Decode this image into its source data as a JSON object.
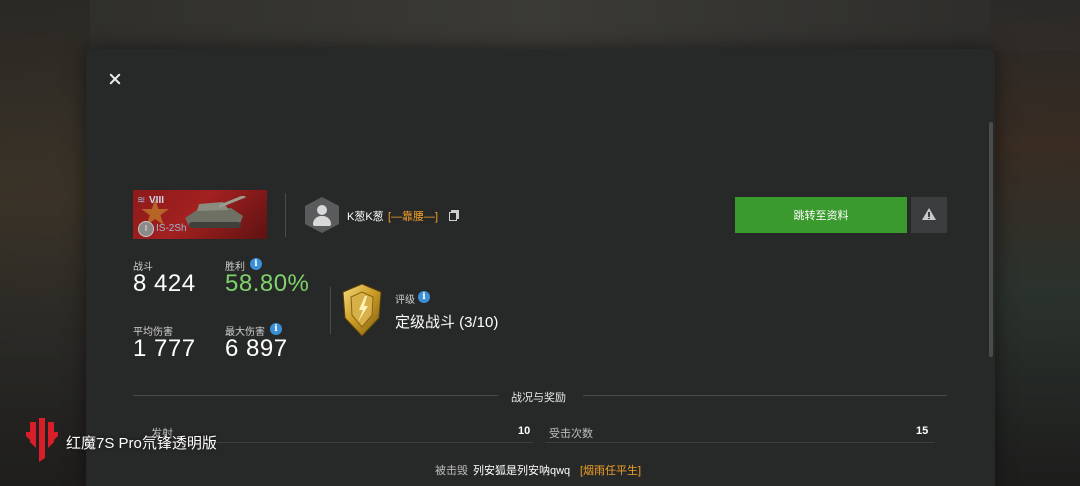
{
  "dialog": {
    "close_icon": "close-icon"
  },
  "vehicle": {
    "tier": "VIII",
    "name": "IS-2Sh",
    "mastery": "I",
    "banner_color": "#a32020"
  },
  "player": {
    "name": "K葱K葱",
    "clan": "[—靠腰—]",
    "avatar_icon": "user-avatar-icon",
    "copy_icon": "copy-icon"
  },
  "actions": {
    "goto_profile_label": "跳转至资料",
    "goto_profile_color": "#3b9a2d",
    "report_icon": "warning-icon"
  },
  "stats": {
    "battles_label": "战斗",
    "battles_value": "8 424",
    "winrate_label": "胜利",
    "winrate_value": "58.80%",
    "winrate_color": "#7fd36a",
    "avg_damage_label": "平均伤害",
    "avg_damage_value": "1 777",
    "max_damage_label": "最大伤害",
    "max_damage_value": "6 897",
    "info_icon": "info-icon"
  },
  "rating": {
    "label": "评级",
    "value": "定级战斗 (3/10)",
    "badge_icon": "gold-rank-shield-icon"
  },
  "battle_report": {
    "section_title": "战况与奖励",
    "rows": [
      {
        "label": "发射",
        "value": "10"
      },
      {
        "label": "受击次数",
        "value": "15"
      }
    ],
    "killed_by_label": "被击毁",
    "killer_name": "列安狐是列安呐qwq",
    "killer_clan": "[烟雨任平生]"
  },
  "watermark": {
    "text": "红魔7S Pro氘锋透明版",
    "logo_icon": "red-magic-logo-icon"
  }
}
